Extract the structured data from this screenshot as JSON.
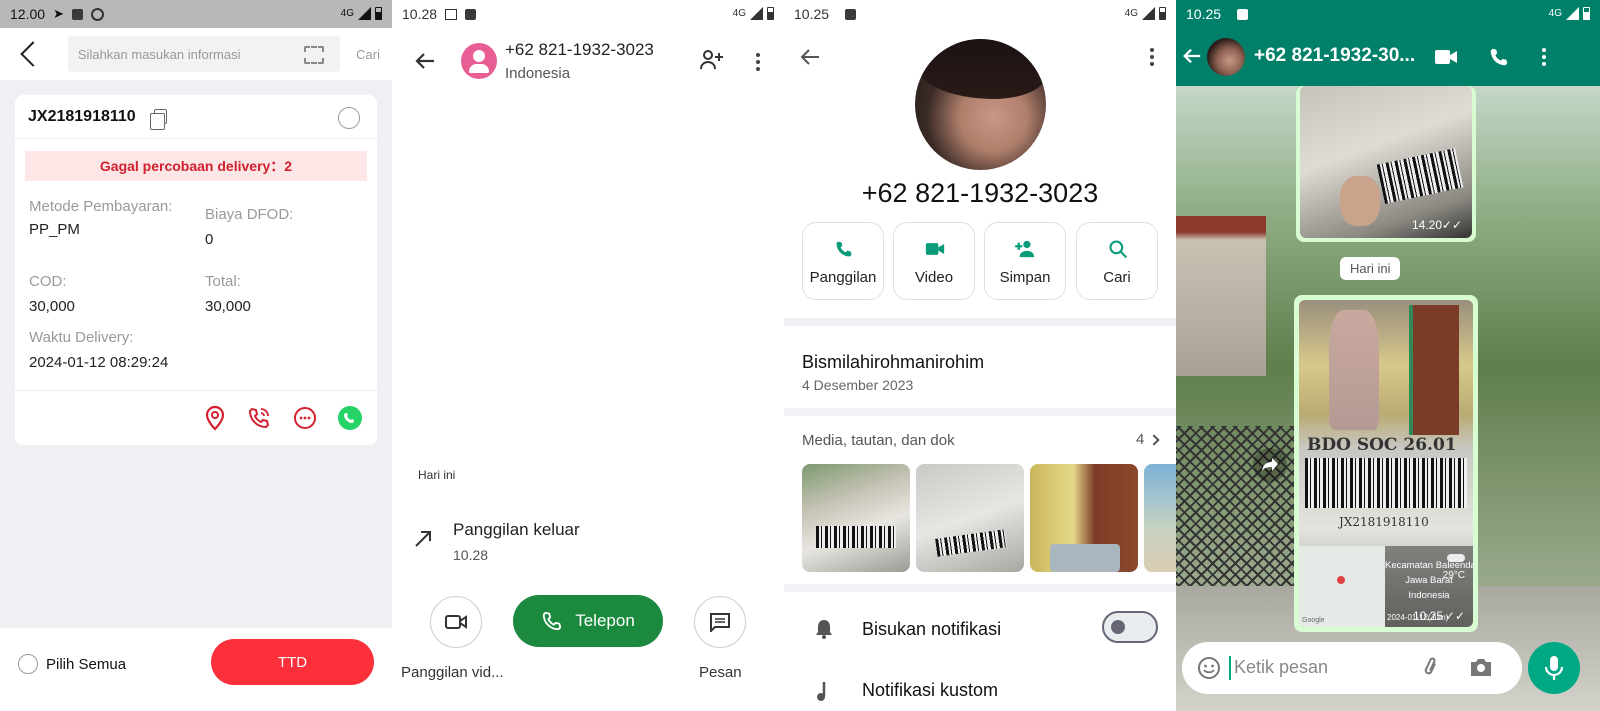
{
  "panel1": {
    "status": {
      "time": "12.00",
      "network": "4G"
    },
    "search": {
      "placeholder": "Silahkan masukan informasi",
      "button": "Cari"
    },
    "card": {
      "waybill": "JX2181918110",
      "fail_banner": "Gagal percobaan delivery：2",
      "fields": [
        {
          "label": "Metode Pembayaran:",
          "value": "PP_PM"
        },
        {
          "label": "Biaya DFOD:",
          "value": "0"
        },
        {
          "label": "COD:",
          "value": "30,000"
        },
        {
          "label": "Total:",
          "value": "30,000"
        },
        {
          "label": "Waktu Delivery:",
          "value": "2024-01-12 08:29:24"
        }
      ]
    },
    "bottom": {
      "select_all": "Pilih Semua",
      "ttd": "TTD"
    },
    "colors": {
      "accent": "#fc303b",
      "whatsapp": "#25d366"
    }
  },
  "panel2": {
    "status": {
      "time": "10.28",
      "network": "4G"
    },
    "contact": {
      "number": "+62 821-1932-3023",
      "country": "Indonesia"
    },
    "day_label": "Hari ini",
    "call": {
      "type": "Panggilan keluar",
      "time": "10.28"
    },
    "actions": {
      "video": "Panggilan vid...",
      "call": "Telepon",
      "message": "Pesan"
    },
    "colors": {
      "call_button": "#1b8a3e",
      "avatar": "#e85d93"
    }
  },
  "panel3": {
    "status": {
      "time": "10.25",
      "network": "4G"
    },
    "profile": {
      "number": "+62 821-1932-3023"
    },
    "actions": [
      "Panggilan",
      "Video",
      "Simpan",
      "Cari"
    ],
    "about": {
      "text": "Bismilahirohmanirohim",
      "date": "4 Desember 2023"
    },
    "media": {
      "label": "Media, tautan, dan dok",
      "count": "4"
    },
    "settings": [
      {
        "label": "Bisukan notifikasi"
      },
      {
        "label": "Notifikasi kustom"
      }
    ],
    "colors": {
      "accent": "#0a9b7a"
    }
  },
  "panel4": {
    "status": {
      "time": "10.25",
      "network": "4G"
    },
    "header": {
      "title": "+62 821-1932-30..."
    },
    "messages": [
      {
        "time": "14.20"
      },
      {
        "time": "10.25",
        "location": [
          "Kecamatan Baleendah",
          "Jawa Barat",
          "Indonesia"
        ],
        "temp": "29°C",
        "stamp": "2024-01-12(Jum)",
        "map_brand": "Google",
        "photo_text": [
          "JX2181918110",
          "BDO SOC 26.01"
        ]
      }
    ],
    "day_chip": "Hari ini",
    "input": {
      "placeholder": "Ketik pesan"
    },
    "colors": {
      "header": "#008069",
      "bubble": "#d9fdd3",
      "mic": "#00a884"
    }
  }
}
